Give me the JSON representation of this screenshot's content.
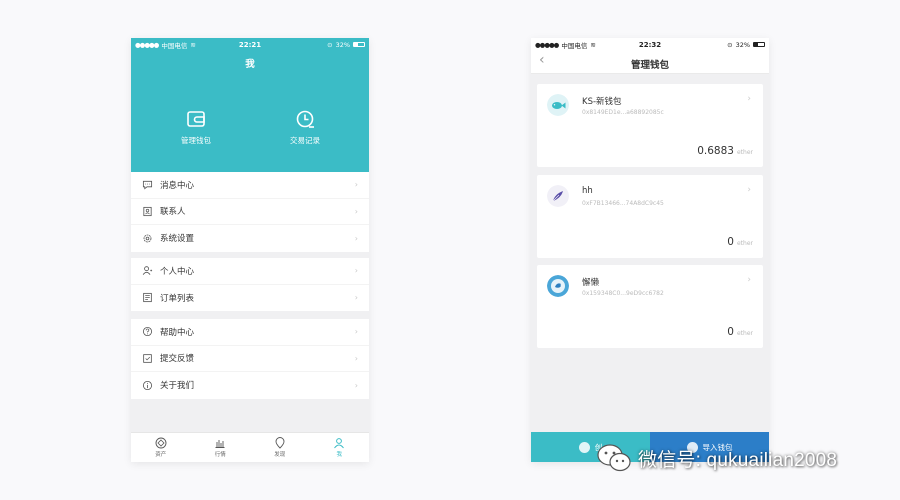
{
  "phone1": {
    "status": {
      "carrier": "中国电信",
      "time": "22:21",
      "battery": "32%"
    },
    "title": "我",
    "actions": [
      {
        "label": "管理钱包",
        "icon": "wallet-icon"
      },
      {
        "label": "交易记录",
        "icon": "clock-icon"
      }
    ],
    "menu_groups": [
      [
        {
          "label": "消息中心",
          "icon": "message-icon"
        },
        {
          "label": "联系人",
          "icon": "contacts-icon"
        },
        {
          "label": "系统设置",
          "icon": "settings-icon"
        }
      ],
      [
        {
          "label": "个人中心",
          "icon": "person-icon"
        },
        {
          "label": "订单列表",
          "icon": "list-icon"
        }
      ],
      [
        {
          "label": "帮助中心",
          "icon": "help-icon"
        },
        {
          "label": "提交反馈",
          "icon": "feedback-icon"
        },
        {
          "label": "关于我们",
          "icon": "info-icon"
        }
      ]
    ],
    "tabs": [
      {
        "label": "资产",
        "icon": "assets-icon",
        "active": false
      },
      {
        "label": "行情",
        "icon": "market-icon",
        "active": false
      },
      {
        "label": "发现",
        "icon": "discover-icon",
        "active": false
      },
      {
        "label": "我",
        "icon": "profile-icon",
        "active": true
      }
    ]
  },
  "phone2": {
    "status": {
      "carrier": "中国电信",
      "time": "22:32",
      "battery": "32%"
    },
    "title": "管理钱包",
    "wallets": [
      {
        "name": "KS-新钱包",
        "address": "0x8149ED1e...a68892085c",
        "balance": "0.6883",
        "unit": "ether",
        "avatar": "fish-avatar"
      },
      {
        "name": "hh",
        "address": "0xF7B13466...74A8dC9c45",
        "balance": "0",
        "unit": "ether",
        "avatar": "feather-avatar"
      },
      {
        "name": "懈懒",
        "address": "0x159348C0...9eD9cc6782",
        "balance": "0",
        "unit": "ether",
        "avatar": "bird-avatar"
      }
    ],
    "buttons": {
      "create": "创",
      "import": "导入钱包"
    }
  },
  "watermark": {
    "text": "微信号: qukuailian2008"
  },
  "colors": {
    "primary": "#3bbcc6",
    "import_button": "#2c7ec8",
    "background": "#f0f0f2"
  }
}
